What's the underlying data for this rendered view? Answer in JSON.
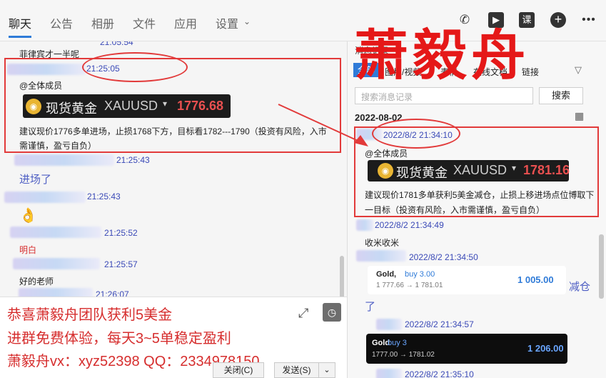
{
  "tabs": [
    "聊天",
    "公告",
    "相册",
    "文件",
    "应用",
    "设置"
  ],
  "left": {
    "msg_partial_time": "21:05:54",
    "msg0": "菲律宾才一半呢",
    "m1_time": "21:25:05",
    "m1_mention": "@全体成员",
    "banner": {
      "name": "现货黄金",
      "symbol": "XAUUSD",
      "arrow": "▾",
      "price": "1776.68"
    },
    "m1_text_a": "建议现价1776多单进场，止损1768下方，目标看1782---1790（投资有风险，入市",
    "m1_text_b": "需谨慎，盈亏自负）",
    "m2_time": "21:25:43",
    "m2_text": "进场了",
    "m3_time": "21:25:43",
    "m3_emoji": "👌",
    "m4_time": "21:25:52",
    "m4_text": "明白",
    "m5_time": "21:25:57",
    "m5_text": "好的老师",
    "m6_time": "21:26:07"
  },
  "input": {
    "promo1": "恭喜萧毅舟团队获利5美金",
    "promo2": "进群免费体验，每天3~5单稳定盈利",
    "promo3": "萧毅舟vx：xyz52398  QQ：2334978150",
    "close": "关闭(C)",
    "send": "发送(S)"
  },
  "right": {
    "header": "消息记录",
    "tabs": [
      "全部",
      "图片/视频",
      "表情",
      "在线文档",
      "链接"
    ],
    "search_placeholder": "搜索消息记录",
    "search_btn": "搜索",
    "date": "2022-08-02",
    "r1_time": "2022/8/2 21:34:10",
    "r1_mention": "@全体成员",
    "banner": {
      "name": "现货黄金",
      "symbol": "XAUUSD",
      "arrow": "▾",
      "price": "1781.16"
    },
    "r1_text_a": "建议现价1781多单获利5美金减仓，止损上移进场点位博取下",
    "r1_text_b": "一目标（投资有风险，入市需谨慎，盈亏自负）",
    "r2_time": "2022/8/2 21:34:49",
    "r2_text": "收米收米",
    "r3_time": "2022/8/2 21:34:50",
    "card1": {
      "symbol": "Gold,",
      "side": "buy 3.00",
      "range": "1 777.66 → 1 781.01",
      "profit": "1 005.00"
    },
    "r3_text_a": "减仓",
    "r3_text_b": "了",
    "r4_time": "2022/8/2 21:34:57",
    "card2": {
      "symbol": "Gold",
      "side": "buy 3",
      "range": "1777.00 → 1781.02",
      "profit": "1 206.00"
    },
    "r5_time": "2022/8/2 21:35:10"
  },
  "overlay_title": "萧毅舟"
}
